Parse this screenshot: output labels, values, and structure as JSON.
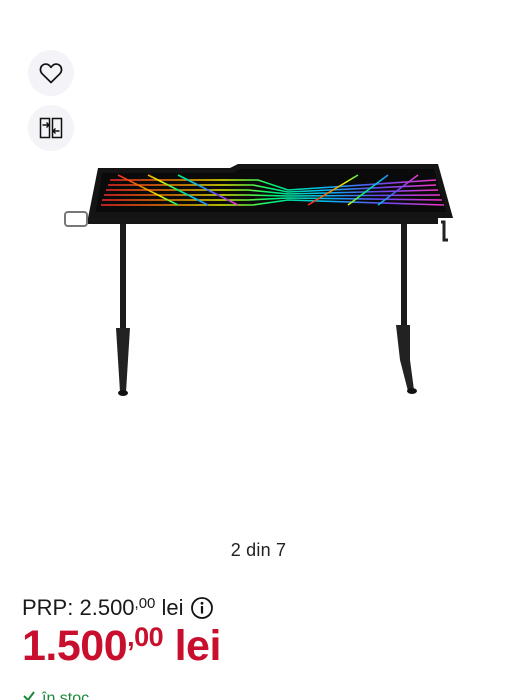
{
  "actions": {
    "wishlist_icon": "heart-icon",
    "compare_icon": "compare-icon"
  },
  "gallery": {
    "counter": "2 din 7"
  },
  "price": {
    "prp_label": "PRP:",
    "prp_integer": "2.500",
    "prp_decimals": ",00",
    "prp_currency": "lei",
    "current_integer": "1.500",
    "current_decimals": ",00",
    "current_currency": "lei"
  },
  "stock": {
    "label": "în stoc"
  },
  "colors": {
    "price_red": "#c8102e",
    "stock_green": "#1a8a3a"
  }
}
